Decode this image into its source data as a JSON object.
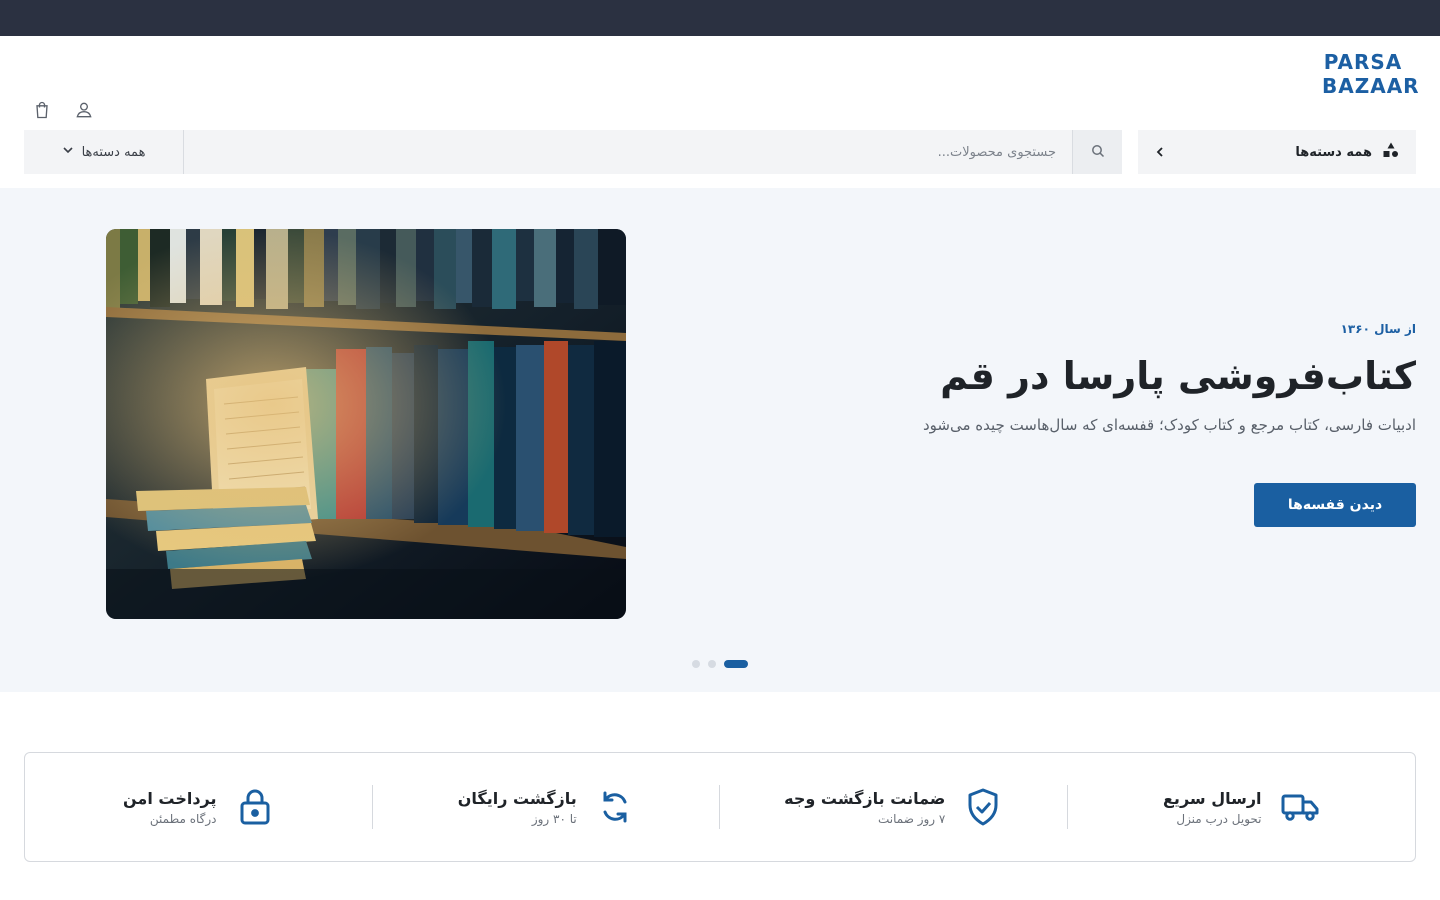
{
  "brand": {
    "line1": "PARSA",
    "line2": "BAZAAR",
    "color": "#1c5fa3"
  },
  "header": {
    "icons": [
      "shopping-bag-icon",
      "user-icon"
    ]
  },
  "search": {
    "category_select": "همه دسته‌ها",
    "placeholder": "جستجوی محصولات...",
    "value": "",
    "all_categories": "همه دسته‌ها"
  },
  "hero": {
    "eyebrow": "از سال ۱۳۶۰",
    "title": "کتاب‌فروشی پارسا در قم",
    "subtitle": "ادبیات فارسی، کتاب مرجع و کتاب کودک؛ قفسه‌ای که سال‌هاست چیده می‌شود",
    "cta": "دیدن قفسه‌ها",
    "slides_total": 3,
    "active_slide": 1,
    "accent": "#1a5fa1"
  },
  "features": [
    {
      "title": "ارسال سریع",
      "subtitle": "تحویل درب منزل",
      "icon": "truck-icon"
    },
    {
      "title": "ضمانت بازگشت وجه",
      "subtitle": "۷ روز ضمانت",
      "icon": "shield-check-icon"
    },
    {
      "title": "بازگشت رایگان",
      "subtitle": "تا ۳۰ روز",
      "icon": "refresh-icon"
    },
    {
      "title": "پرداخت امن",
      "subtitle": "درگاه مطمئن",
      "icon": "lock-icon"
    }
  ]
}
